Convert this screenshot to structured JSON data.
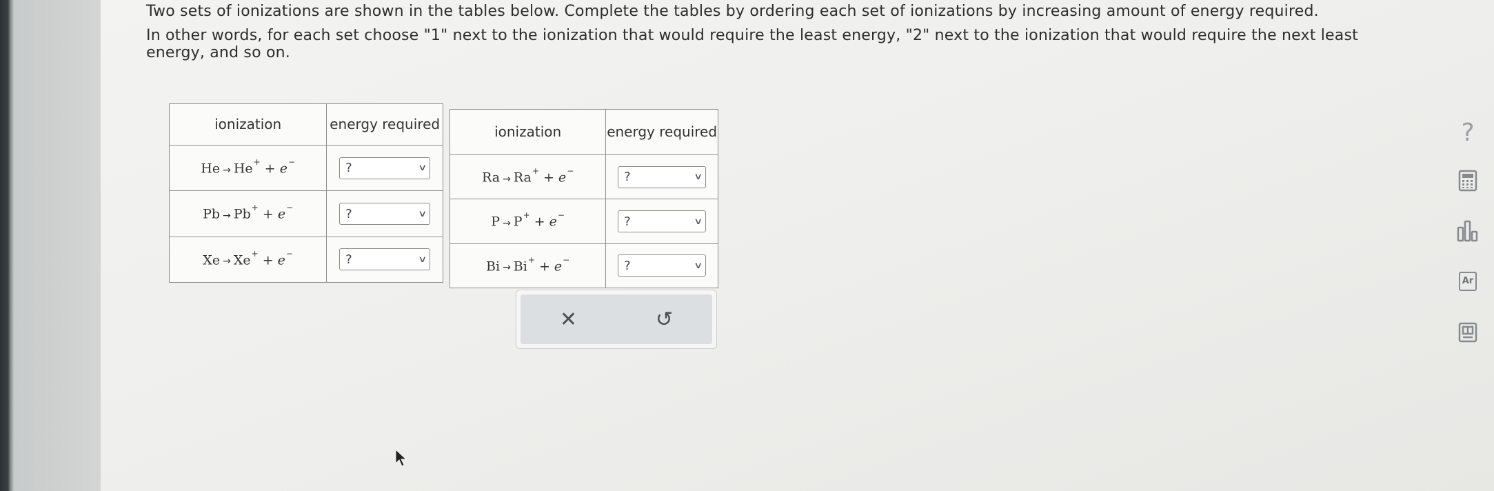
{
  "instructions": {
    "line1": "Two sets of ionizations are shown in the tables below. Complete the tables by ordering each set of ionizations by increasing amount of energy required.",
    "line2": "In other words, for each set choose \"1\" next to the ionization that would require the least energy, \"2\" next to the ionization that would require the next least energy, and so on."
  },
  "table1": {
    "header_ionization": "ionization",
    "header_energy": "energy required",
    "rows": [
      {
        "reactant": "He",
        "product": "He",
        "charge": "+",
        "electron": "e",
        "electron_charge": "−",
        "value": "?"
      },
      {
        "reactant": "Pb",
        "product": "Pb",
        "charge": "+",
        "electron": "e",
        "electron_charge": "−",
        "value": "?"
      },
      {
        "reactant": "Xe",
        "product": "Xe",
        "charge": "+",
        "electron": "e",
        "electron_charge": "−",
        "value": "?"
      }
    ]
  },
  "table2": {
    "header_ionization": "ionization",
    "header_energy": "energy required",
    "rows": [
      {
        "reactant": "Ra",
        "product": "Ra",
        "charge": "+",
        "electron": "e",
        "electron_charge": "−",
        "value": "?"
      },
      {
        "reactant": "P",
        "product": "P",
        "charge": "+",
        "electron": "e",
        "electron_charge": "−",
        "value": "?"
      },
      {
        "reactant": "Bi",
        "product": "Bi",
        "charge": "+",
        "electron": "e",
        "electron_charge": "−",
        "value": "?"
      }
    ]
  },
  "equation_symbols": {
    "arrow": "→",
    "plus": "+"
  },
  "actions": {
    "clear_icon": "✕",
    "undo_icon": "↺"
  },
  "side_tools": {
    "help": "?",
    "periodic_label": "Ar"
  },
  "icons": [
    "chevron-down-icon",
    "close-icon",
    "undo-icon",
    "help-icon",
    "calculator-icon",
    "chart-icon",
    "periodic-table-icon",
    "book-icon",
    "mouse-cursor-icon"
  ],
  "colors": {
    "panel_gray": "#dcdfe1",
    "text": "#2d2d2d",
    "border": "#8d8d8d"
  }
}
